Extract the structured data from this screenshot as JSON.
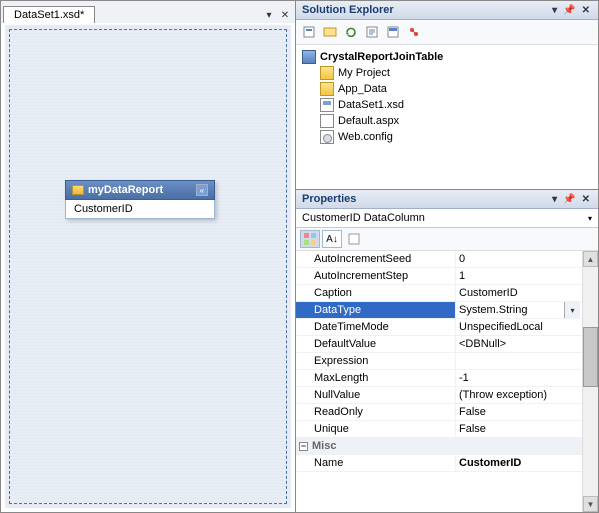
{
  "tab": {
    "title": "DataSet1.xsd*"
  },
  "table": {
    "name": "myDataReport",
    "column": "CustomerID"
  },
  "solutionExplorer": {
    "title": "Solution Explorer",
    "project": "CrystalReportJoinTable",
    "items": [
      {
        "label": "My Project",
        "ico": "ico-folder"
      },
      {
        "label": "App_Data",
        "ico": "ico-folder"
      },
      {
        "label": "DataSet1.xsd",
        "ico": "ico-xsd"
      },
      {
        "label": "Default.aspx",
        "ico": "ico-aspx"
      },
      {
        "label": "Web.config",
        "ico": "ico-cfg"
      }
    ]
  },
  "properties": {
    "title": "Properties",
    "selection": "CustomerID DataColumn",
    "rows": [
      {
        "name": "AutoIncrementSeed",
        "val": "0"
      },
      {
        "name": "AutoIncrementStep",
        "val": "1"
      },
      {
        "name": "Caption",
        "val": "CustomerID"
      },
      {
        "name": "DataType",
        "val": "System.String",
        "selected": true,
        "dropdown": true
      },
      {
        "name": "DateTimeMode",
        "val": "UnspecifiedLocal"
      },
      {
        "name": "DefaultValue",
        "val": "<DBNull>"
      },
      {
        "name": "Expression",
        "val": ""
      },
      {
        "name": "MaxLength",
        "val": "-1"
      },
      {
        "name": "NullValue",
        "val": "(Throw exception)"
      },
      {
        "name": "ReadOnly",
        "val": "False"
      },
      {
        "name": "Unique",
        "val": "False"
      }
    ],
    "misc": {
      "label": "Misc",
      "name": "Name",
      "val": "CustomerID"
    }
  }
}
